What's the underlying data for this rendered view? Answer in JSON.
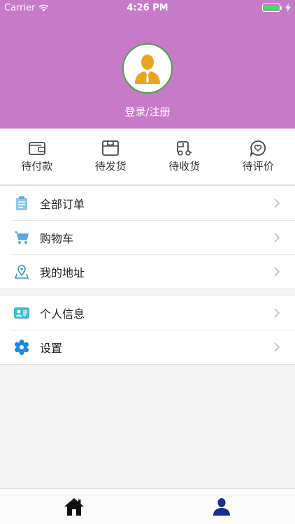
{
  "status_bar": {
    "carrier": "Carrier",
    "time": "4:26 PM"
  },
  "header": {
    "login_text": "登录/注册",
    "accent": "#c77ac8"
  },
  "orders": [
    {
      "label": "待付款",
      "icon": "wallet-icon"
    },
    {
      "label": "待发货",
      "icon": "box-icon"
    },
    {
      "label": "待收货",
      "icon": "truck-icon"
    },
    {
      "label": "待评价",
      "icon": "heart-bubble-icon"
    }
  ],
  "menu_group_1": [
    {
      "label": "全部订单",
      "icon": "clipboard-icon"
    },
    {
      "label": "购物车",
      "icon": "cart-icon"
    },
    {
      "label": "我的地址",
      "icon": "location-pin-icon"
    }
  ],
  "menu_group_2": [
    {
      "label": "个人信息",
      "icon": "id-card-icon"
    },
    {
      "label": "设置",
      "icon": "gear-icon"
    }
  ],
  "tabbar": [
    {
      "icon": "home-icon"
    },
    {
      "icon": "user-icon"
    }
  ]
}
